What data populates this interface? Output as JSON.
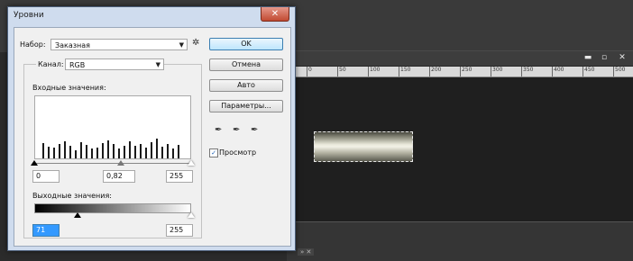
{
  "dialog": {
    "title": "Уровни",
    "close_glyph": "✕",
    "preset_label": "Набор:",
    "preset_value": "Заказная",
    "channel_label": "Канал:",
    "channel_value": "RGB",
    "input_label": "Входные значения:",
    "input_black": "0",
    "input_gamma": "0,82",
    "input_white": "255",
    "output_label": "Выходные значения:",
    "output_black": "71",
    "output_white": "255",
    "buttons": {
      "ok": "OK",
      "cancel": "Отмена",
      "auto": "Авто",
      "options": "Параметры..."
    },
    "preview_label": "Просмотр",
    "preview_checked": true,
    "eyedropper_glyph": "✒"
  },
  "document": {
    "ruler_labels": [
      "0",
      "50",
      "100",
      "150",
      "200",
      "250",
      "300",
      "350",
      "400",
      "450",
      "500"
    ],
    "window_buttons": [
      "▬",
      "▫",
      "✕"
    ]
  },
  "histogram": {
    "bars": [
      0.55,
      0.42,
      0.38,
      0.5,
      0.62,
      0.45,
      0.3,
      0.58,
      0.48,
      0.36,
      0.4,
      0.55,
      0.65,
      0.5,
      0.34,
      0.46,
      0.6,
      0.44,
      0.52,
      0.38,
      0.57,
      0.7,
      0.42,
      0.5,
      0.35,
      0.48
    ]
  },
  "colors": {
    "dialog_frame": "#cfdcee",
    "ok_border": "#3c7fb1",
    "close": "#c14a32"
  }
}
